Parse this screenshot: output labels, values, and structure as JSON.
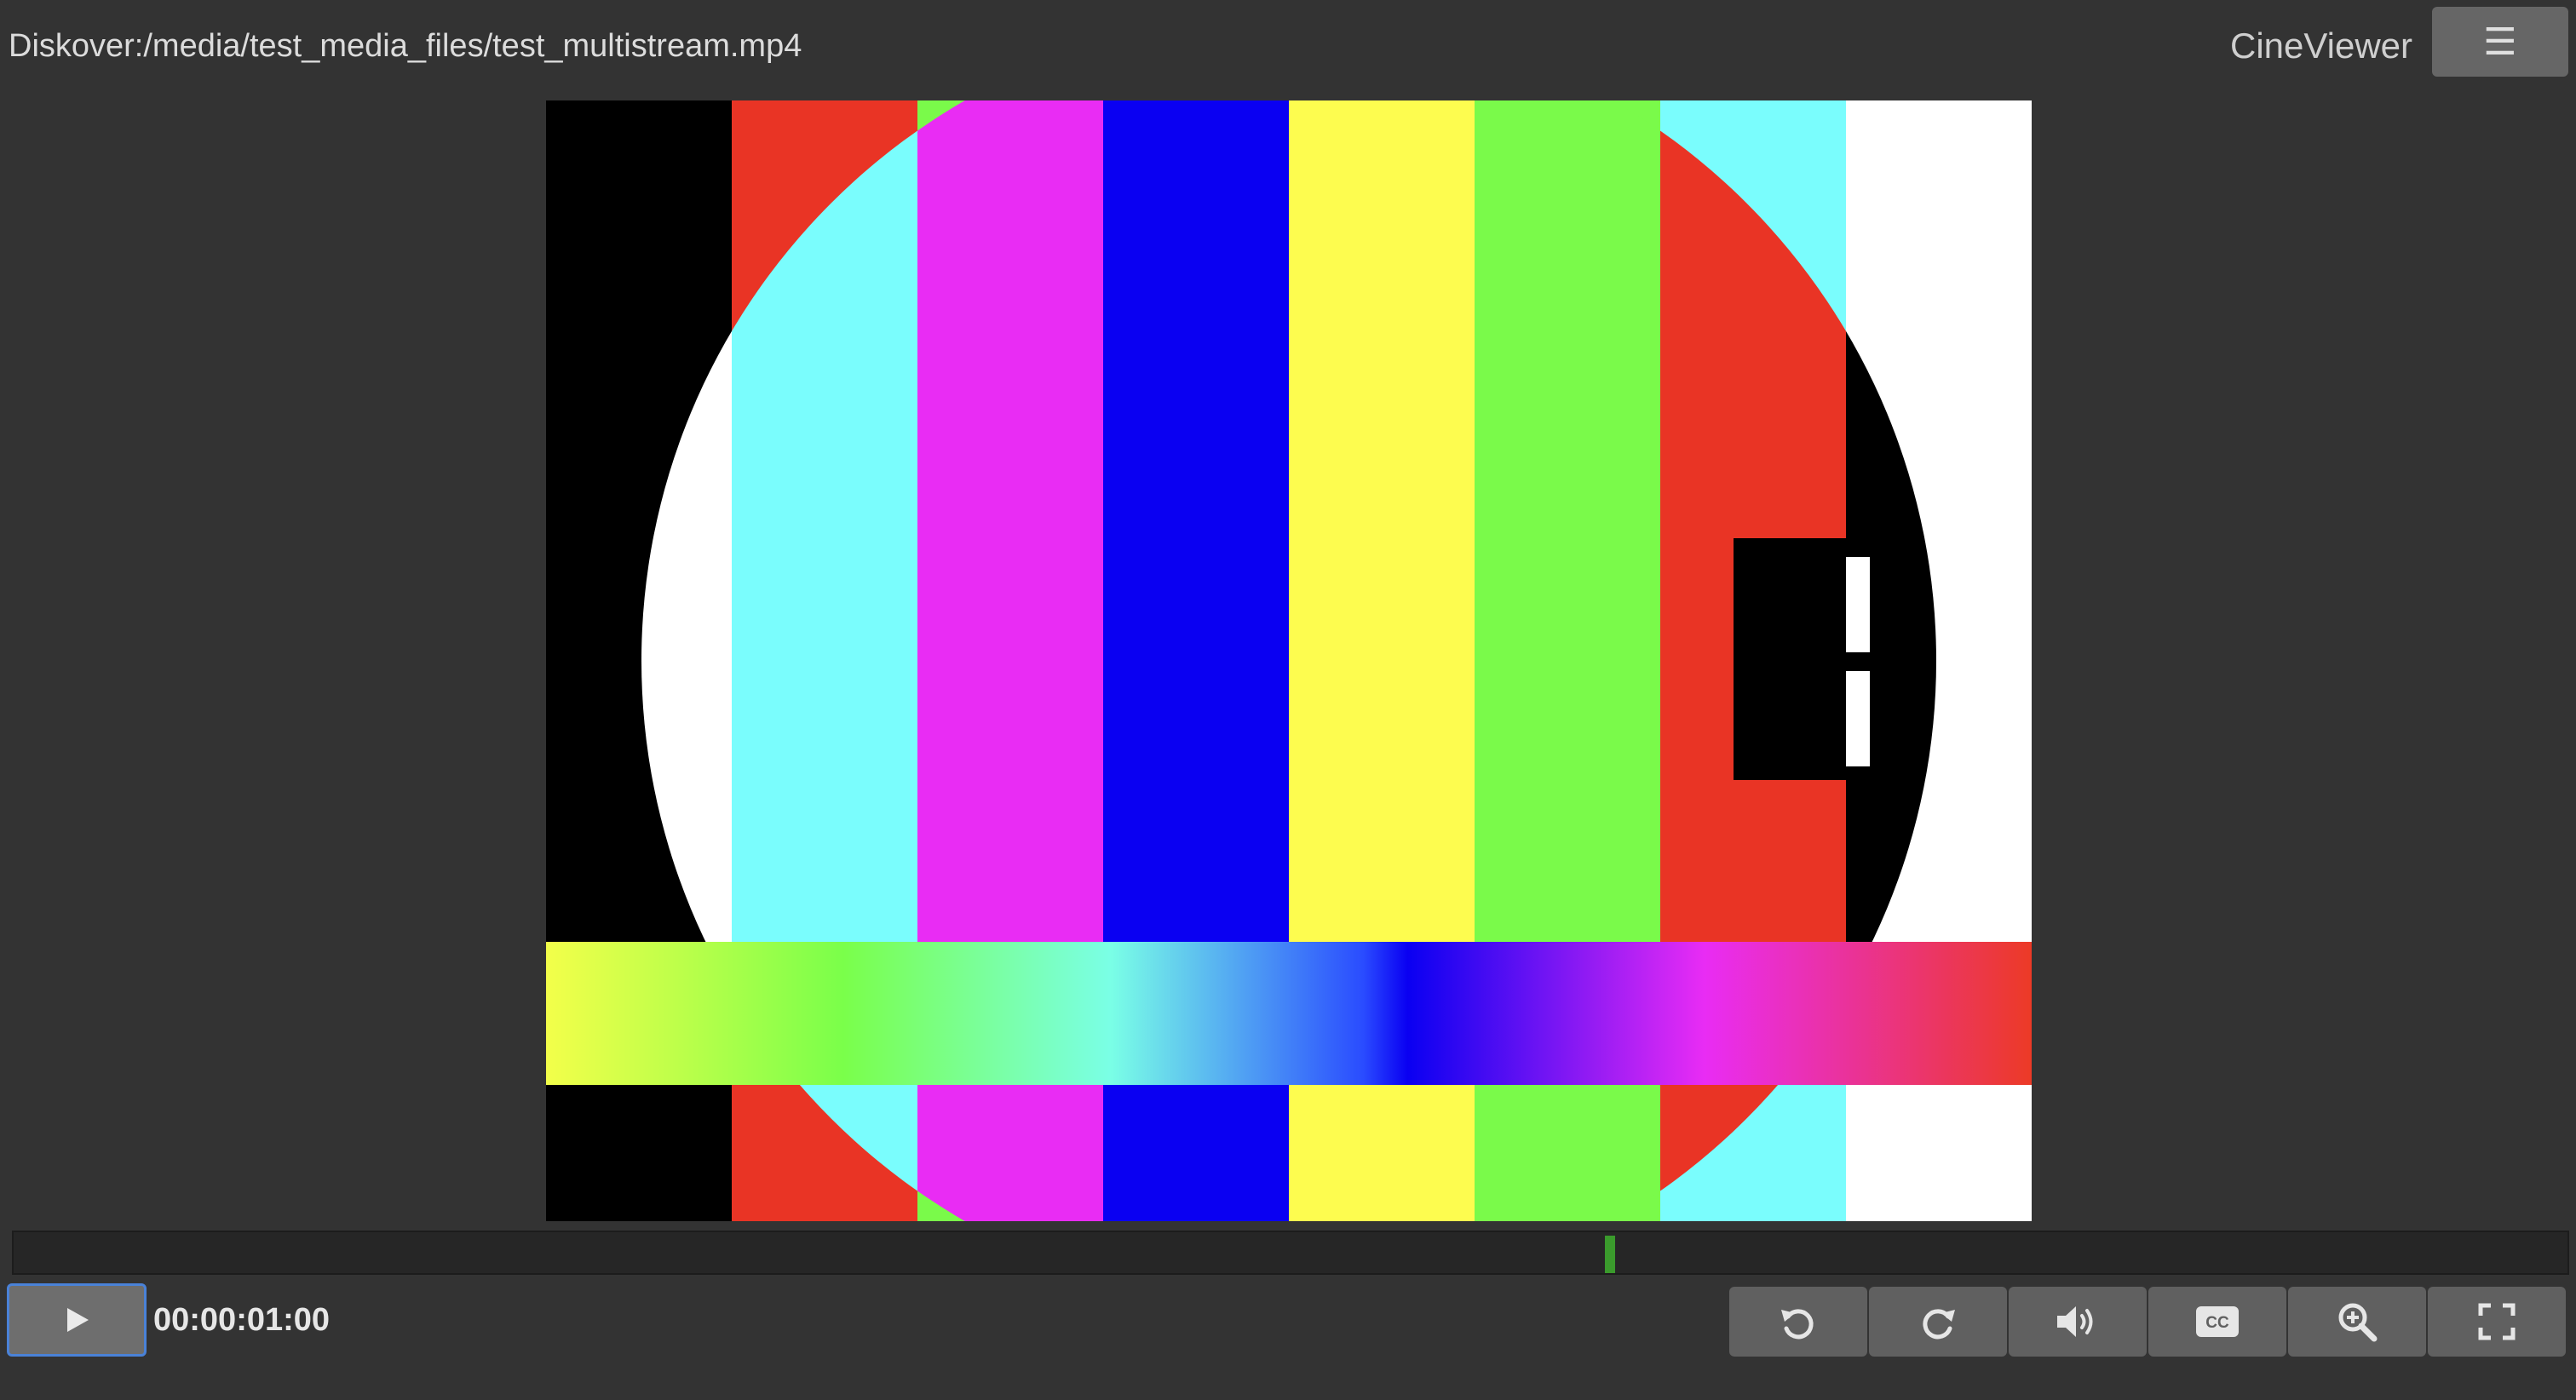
{
  "header": {
    "file_path": "Diskover:/media/test_media_files/test_multistream.mp4",
    "app_name": "CineViewer",
    "menu_icon": "hamburger-menu-icon"
  },
  "player": {
    "timecode": "00:00:01:00",
    "progress_fraction": 0.625,
    "controls": [
      {
        "name": "play-button",
        "icon": "play-icon"
      },
      {
        "name": "rewind-button",
        "icon": "rotate-ccw-icon"
      },
      {
        "name": "forward-button",
        "icon": "rotate-cw-icon"
      },
      {
        "name": "volume-button",
        "icon": "speaker-icon"
      },
      {
        "name": "captions-button",
        "icon": "cc-icon",
        "label": "CC"
      },
      {
        "name": "zoom-button",
        "icon": "zoom-in-icon"
      },
      {
        "name": "fullscreen-button",
        "icon": "fullscreen-icon"
      }
    ]
  },
  "colors": {
    "background": "#333333",
    "button": "#606060",
    "playhead": "#3a9a2c",
    "focus_outline": "#4a82d8"
  }
}
